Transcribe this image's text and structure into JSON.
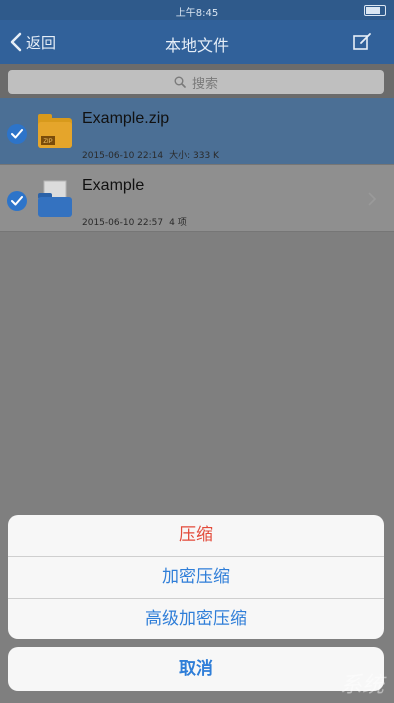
{
  "status_bar": {
    "carrier": "",
    "time": "上午8:45"
  },
  "nav": {
    "back_label": "返回",
    "title": "本地文件"
  },
  "search": {
    "placeholder": "搜索"
  },
  "files": [
    {
      "name": "Example.zip",
      "date": "2015-06-10 22:14",
      "info": "大小: 333 K",
      "type": "zip",
      "selected": true
    },
    {
      "name": "Example",
      "date": "2015-06-10 22:57",
      "info": "4 项",
      "type": "folder",
      "selected": true
    }
  ],
  "action_sheet": {
    "options": [
      {
        "label": "压缩",
        "style": "destructive"
      },
      {
        "label": "加密压缩",
        "style": "default"
      },
      {
        "label": "高级加密压缩",
        "style": "default"
      }
    ],
    "cancel_label": "取消"
  },
  "colors": {
    "accent": "#2f7ed8",
    "destructive": "#e34a3a",
    "nav": "#31619a"
  },
  "watermark": "系统"
}
